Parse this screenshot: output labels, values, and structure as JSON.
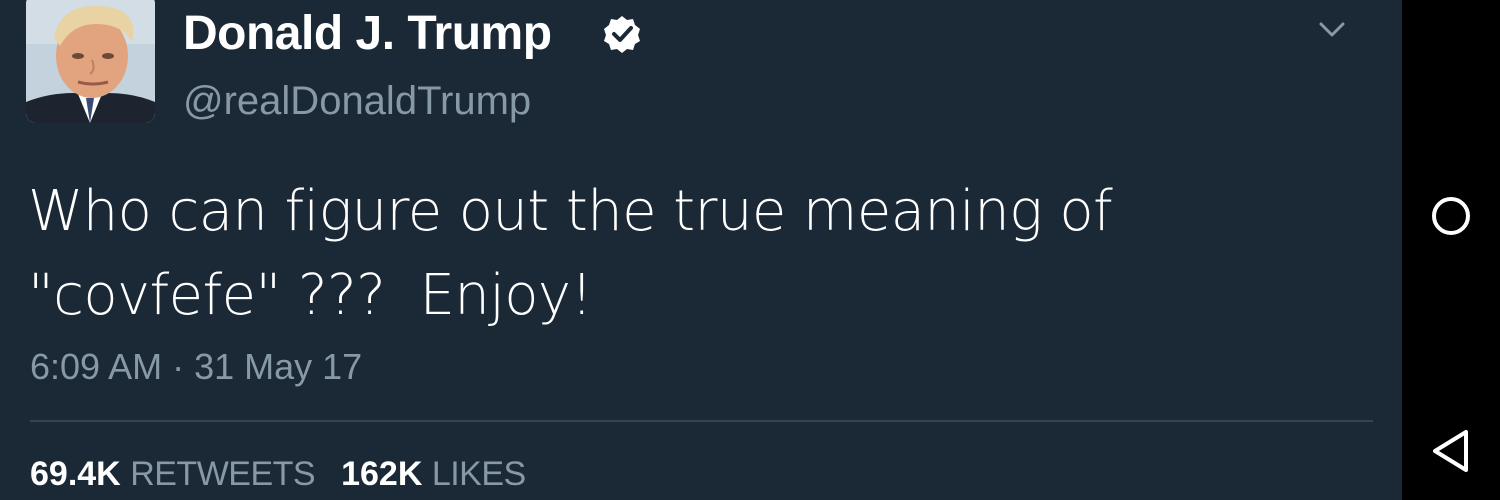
{
  "tweet": {
    "author_name": "Donald J. Trump",
    "handle": "@realDonaldTrump",
    "verified": true,
    "text": "Who can figure out the true meaning of\n\"covfefe\" ???  Enjoy!",
    "time": "6:09 AM",
    "separator": " · ",
    "date": "31 May 17",
    "retweets_count": "69.4K",
    "retweets_label": "RETWEETS",
    "likes_count": "162K",
    "likes_label": "LIKES"
  },
  "icons": {
    "verified": "verified-badge-icon",
    "caret": "chevron-down-icon",
    "nav_home": "home-circle-icon",
    "nav_back": "back-triangle-icon",
    "nav_recents": "recents-icon"
  },
  "colors": {
    "background": "#1b2836",
    "text_primary": "#ffffff",
    "text_secondary": "#8899a6",
    "divider": "#38444d",
    "nav_bar": "#000000"
  }
}
